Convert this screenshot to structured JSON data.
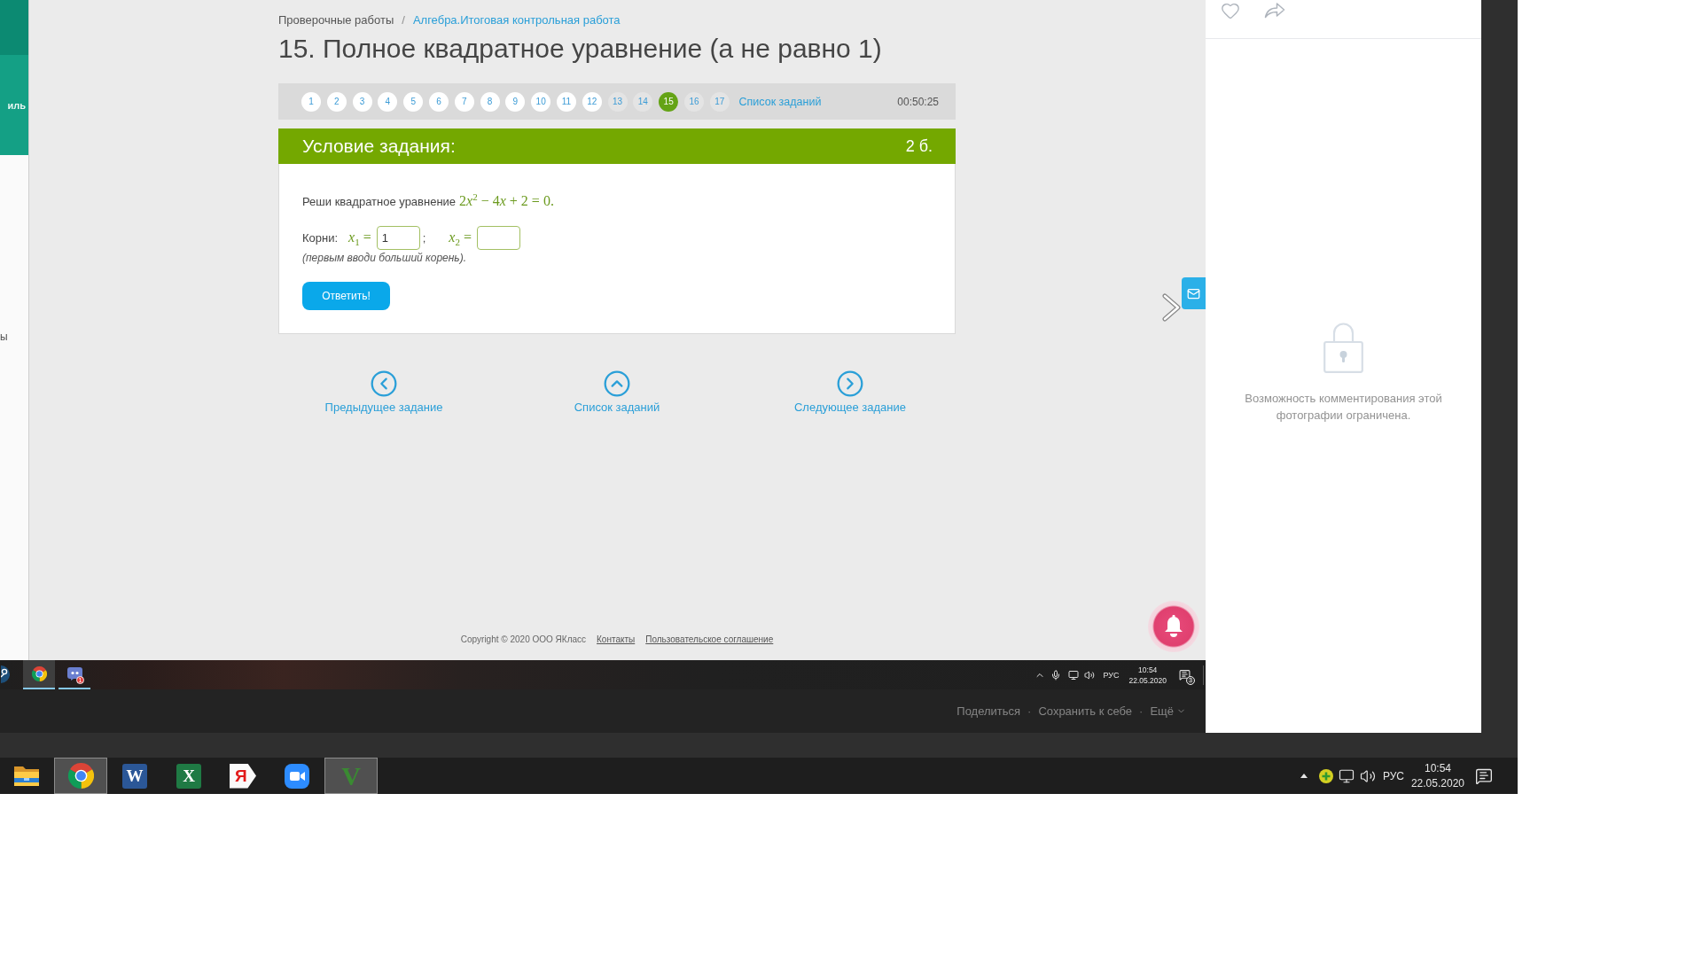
{
  "sidebar": {
    "menu_item": "иль",
    "text": "ы"
  },
  "breadcrumb": {
    "items": [
      {
        "label": "Проверочные работы",
        "kind": "text"
      },
      {
        "label": "Алгебра.Итоговая контрольная работа",
        "kind": "link"
      }
    ],
    "separator": "/"
  },
  "title": "15. Полное квадратное уравнение (а не равно 1)",
  "task_nav": {
    "numbers": [
      {
        "label": "1",
        "filled": true,
        "selected": false
      },
      {
        "label": "2",
        "filled": true,
        "selected": false
      },
      {
        "label": "3",
        "filled": true,
        "selected": false
      },
      {
        "label": "4",
        "filled": true,
        "selected": false
      },
      {
        "label": "5",
        "filled": true,
        "selected": false
      },
      {
        "label": "6",
        "filled": true,
        "selected": false
      },
      {
        "label": "7",
        "filled": true,
        "selected": false
      },
      {
        "label": "8",
        "filled": true,
        "selected": false
      },
      {
        "label": "9",
        "filled": true,
        "selected": false
      },
      {
        "label": "10",
        "filled": true,
        "selected": false
      },
      {
        "label": "11",
        "filled": true,
        "selected": false
      },
      {
        "label": "12",
        "filled": true,
        "selected": false
      },
      {
        "label": "13",
        "filled": false,
        "selected": false
      },
      {
        "label": "14",
        "filled": false,
        "selected": false
      },
      {
        "label": "15",
        "filled": false,
        "selected": true
      },
      {
        "label": "16",
        "filled": false,
        "selected": false
      },
      {
        "label": "17",
        "filled": false,
        "selected": false
      }
    ],
    "list_link": "Список заданий",
    "timer": "00:50:25"
  },
  "task_card": {
    "header": "Условие задания:",
    "points": "2 б.",
    "statement": "Реши квадратное уравнение",
    "formula": [
      "2",
      "*x*$^{2}$ − 4",
      "*x* + 2 = 0."
    ],
    "roots_label": "Корни:",
    "roots": [
      {
        "variable": "*x*$_{1}$ =",
        "value": "1"
      },
      {
        "variable": "*x*$_{2}$ ="
      }
    ],
    "roots_separator": ";",
    "hint": "(первым вводи больший корень).",
    "submit_button": "Ответить!"
  },
  "bottom_nav": [
    {
      "kind": "prev",
      "label": "Предыдущее задание"
    },
    {
      "kind": "list",
      "label": "Список заданий"
    },
    {
      "kind": "next",
      "label": "Следующее задание"
    }
  ],
  "footer": {
    "copyright": "Copyright © 2020 ООО ЯКласс",
    "links": [
      "Контакты",
      "Пользовательское соглашение"
    ]
  },
  "photo_taskbar": {
    "apps": [
      {
        "kind": "steam",
        "running": false,
        "active": false
      },
      {
        "kind": "chrome",
        "running": true,
        "active": true
      },
      {
        "kind": "chat",
        "running": true,
        "active": false,
        "badge": "1"
      }
    ],
    "language": "РУС",
    "time": "10:54",
    "date": "22.05.2020",
    "notifications": "3"
  },
  "photo_actions": {
    "items": [
      {
        "kind": "link",
        "label": "Поделиться"
      },
      {
        "kind": "link",
        "label": "Сохранить к себе"
      },
      {
        "kind": "menu",
        "label": "Ещё"
      }
    ],
    "separator": "·"
  },
  "comments_panel": {
    "message": "Возможность комментирования этой фотографии ограничена."
  },
  "taskbar": {
    "apps": [
      {
        "kind": "explorer",
        "active": false
      },
      {
        "kind": "chrome",
        "active": true
      },
      {
        "kind": "word",
        "glyph": "W",
        "active": false
      },
      {
        "kind": "excel",
        "glyph": "X",
        "active": false
      },
      {
        "kind": "yandex",
        "glyph": "Я",
        "active": false
      },
      {
        "kind": "zoom",
        "active": false
      },
      {
        "kind": "vapp",
        "glyph": "V",
        "active": true
      }
    ],
    "language": "РУС",
    "time": "10:54",
    "date": "22.05.2020"
  }
}
